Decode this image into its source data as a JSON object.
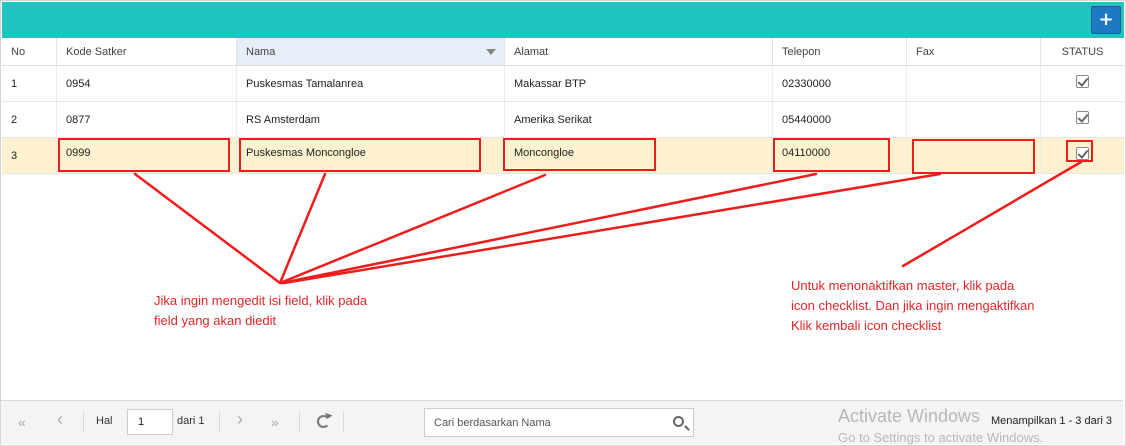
{
  "toolbar": {
    "add_icon": "plus-icon",
    "add_symbol": "+"
  },
  "columns": [
    "No",
    "Kode Satker",
    "Nama",
    "Alamat",
    "Telepon",
    "Fax",
    "STATUS"
  ],
  "rows": [
    {
      "no": "1",
      "kode": "0954",
      "nama": "Puskesmas Tamalanrea",
      "alamat": "Makassar BTP",
      "telepon": "02330000",
      "fax": "",
      "status": "checked"
    },
    {
      "no": "2",
      "kode": "0877",
      "nama": "RS Amsterdam",
      "alamat": "Amerika Serikat",
      "telepon": "05440000",
      "fax": "",
      "status": "checked"
    },
    {
      "no": "3",
      "kode": "0999",
      "nama": "Puskesmas Moncongloe",
      "alamat": "Moncongloe",
      "telepon": "04110000",
      "fax": "",
      "status": "checked"
    }
  ],
  "annotations": {
    "left": [
      "Jika ingin mengedit isi field, klik pada",
      "field yang akan diedit"
    ],
    "right": [
      "Untuk menonaktifkan master, klik pada",
      "icon checklist. Dan jika ingin mengaktifkan",
      "Klik kembali icon checklist"
    ],
    "color": "#ee1c1c"
  },
  "pager": {
    "first_icon": "double-chevron-left-icon",
    "prev_icon": "chevron-left-icon",
    "next_icon": "chevron-right-icon",
    "last_icon": "double-chevron-right-icon",
    "first_symbol": "«",
    "prev_symbol": "‹",
    "next_symbol": "›",
    "last_symbol": "»",
    "hal_label": "Hal",
    "page_value": "1",
    "of_label": "dari 1",
    "refresh_icon": "refresh-icon"
  },
  "search": {
    "placeholder": "Cari berdasarkan Nama",
    "icon": "search-icon"
  },
  "info": "Menampilkan 1 - 3 dari 3",
  "watermark": {
    "line1": "Activate Windows",
    "line2": "Go to Settings to activate Windows."
  },
  "colors": {
    "topbar": "#1ec6bf",
    "add_button": "#1d79c4",
    "selected_row": "#fdf1cf",
    "annotation": "#e32626"
  }
}
